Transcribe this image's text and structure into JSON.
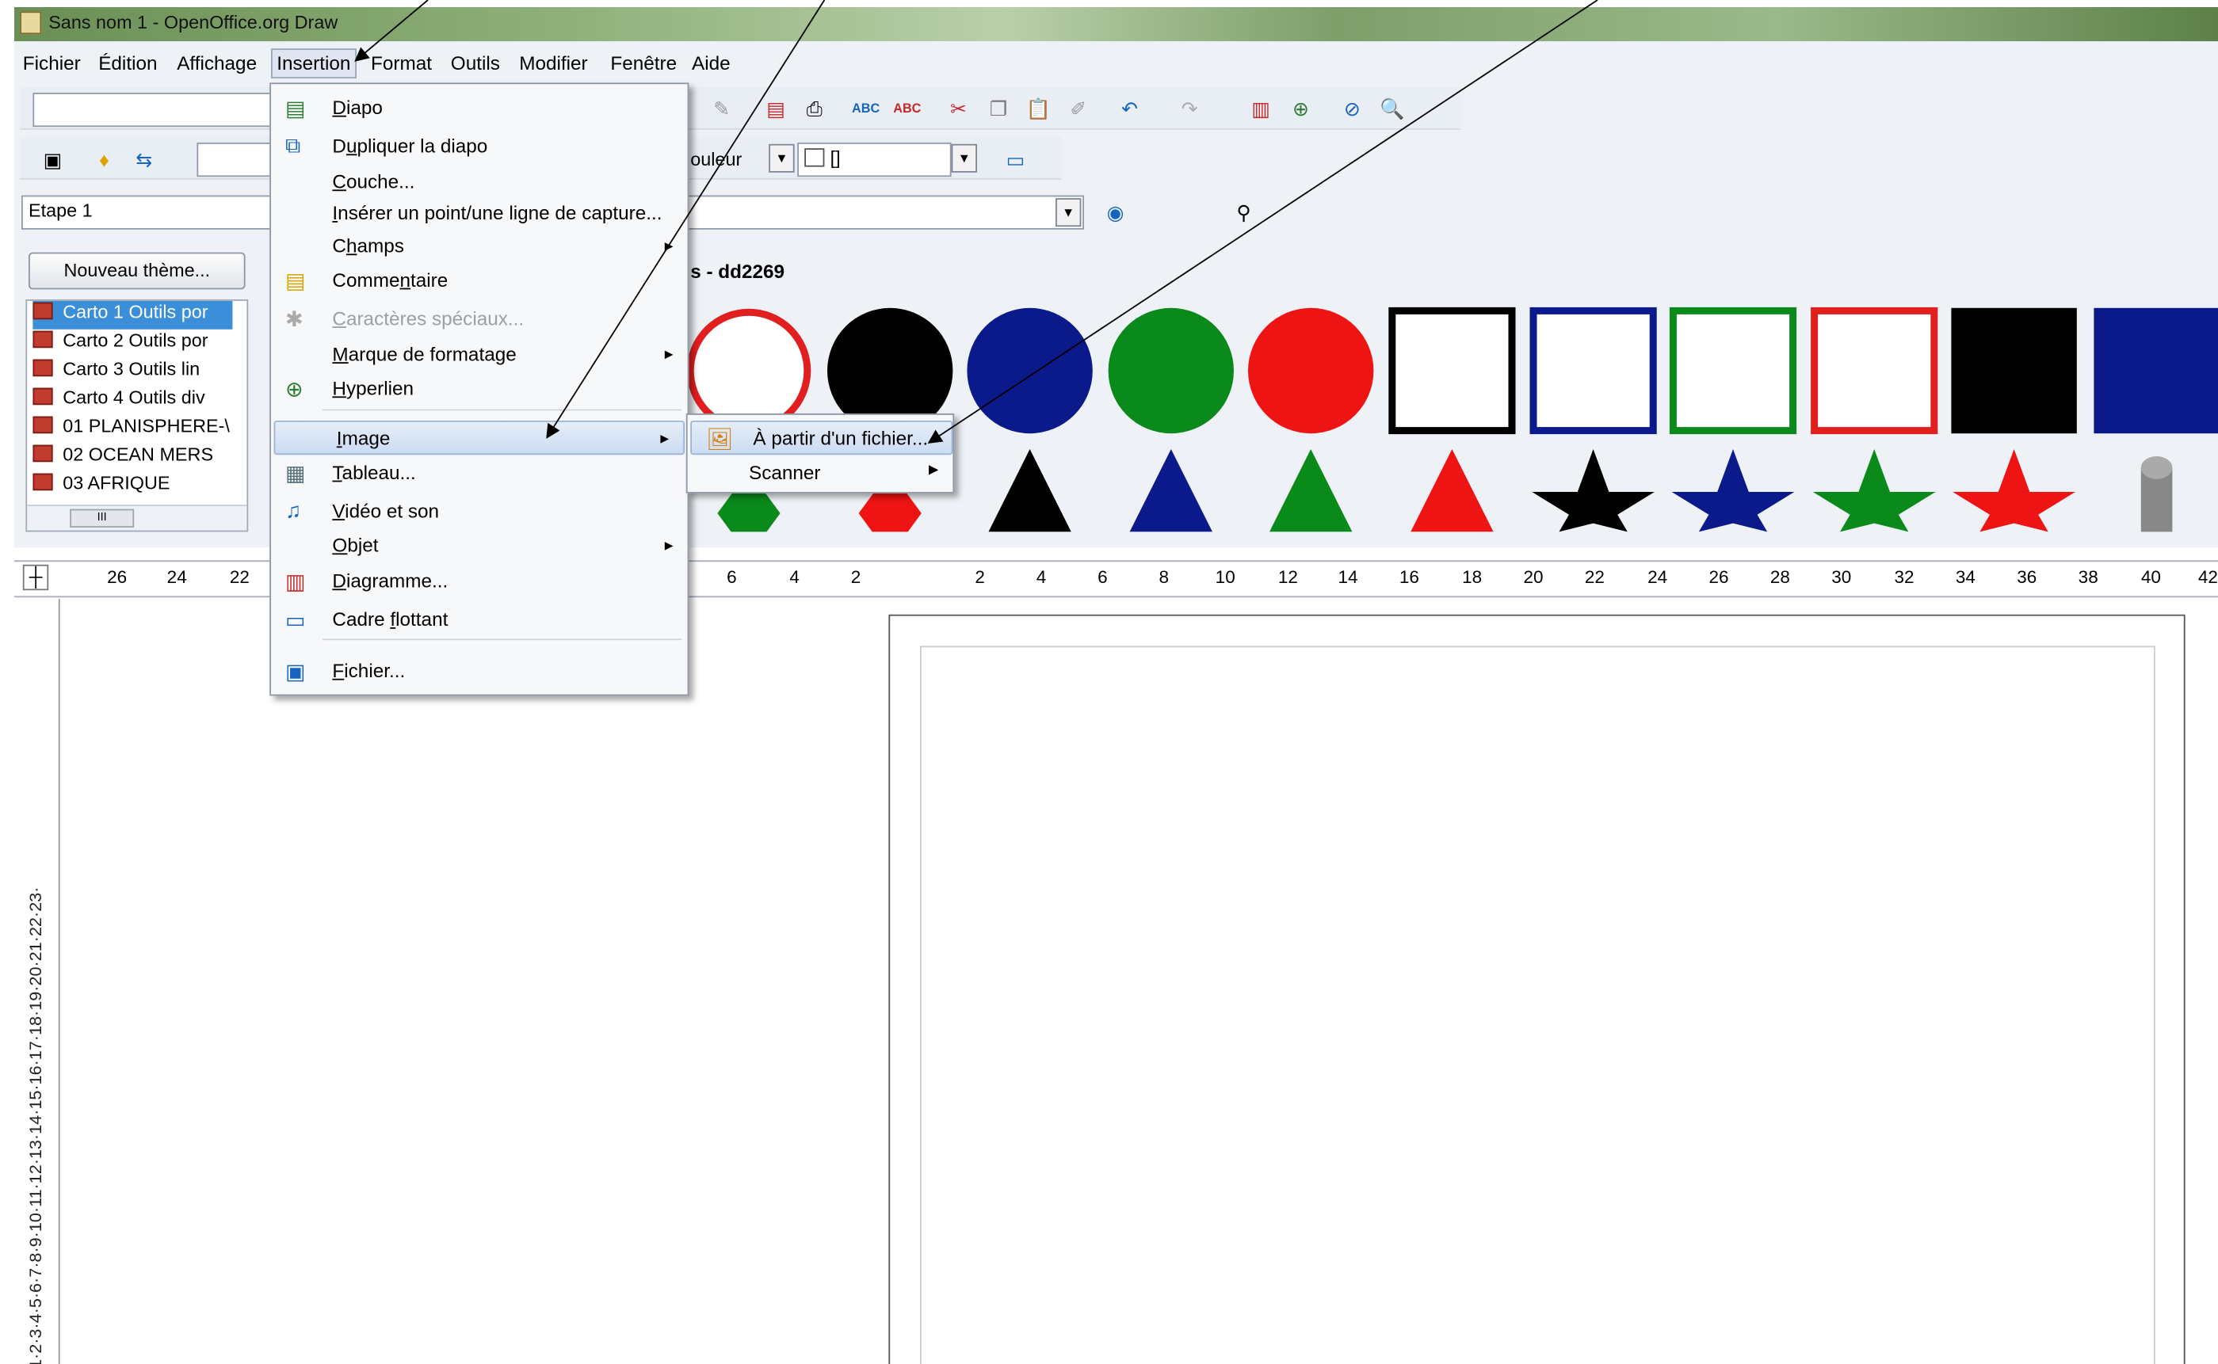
{
  "window": {
    "title": "Sans nom 1 - OpenOffice.org Draw"
  },
  "menubar": [
    "Fichier",
    "Édition",
    "Affichage",
    "Insertion",
    "Format",
    "Outils",
    "Modifier",
    "Fenêtre",
    "Aide"
  ],
  "toolbar2": {
    "color_label": "ouleur",
    "fill_value": "[]"
  },
  "toolbar3": {
    "step_value": "Etape 1"
  },
  "gallery": {
    "new_theme_button": "Nouveau thème...",
    "title": "s - dd2269",
    "themes": [
      "Carto 1 Outils por",
      "Carto 2 Outils por",
      "Carto 3 Outils  lin",
      "Carto 4 Outils div",
      "01 PLANISPHERE-\\",
      "02 OCEAN MERS",
      "03 AFRIQUE"
    ],
    "selected_theme": "Carto 1 Outils por",
    "scroll_thumb": "III",
    "shapes_row1": [
      {
        "shape": "circle-outline",
        "color": "#e21f1f"
      },
      {
        "shape": "circle",
        "color": "#000000"
      },
      {
        "shape": "circle",
        "color": "#0b1a8a"
      },
      {
        "shape": "circle",
        "color": "#0a8a1a"
      },
      {
        "shape": "circle",
        "color": "#ef1414"
      },
      {
        "shape": "square-outline",
        "color": "#000000"
      },
      {
        "shape": "square-outline",
        "color": "#0b1a8a"
      },
      {
        "shape": "square-outline",
        "color": "#0a8a1a"
      },
      {
        "shape": "square-outline",
        "color": "#e21f1f"
      },
      {
        "shape": "square",
        "color": "#000000"
      },
      {
        "shape": "square",
        "color": "#0b1a8a"
      }
    ],
    "shapes_row2": [
      {
        "shape": "hexagon",
        "color": "#0a8a1a"
      },
      {
        "shape": "hexagon",
        "color": "#ef1414"
      },
      {
        "shape": "triangle",
        "color": "#000000"
      },
      {
        "shape": "triangle",
        "color": "#0b1a8a"
      },
      {
        "shape": "triangle",
        "color": "#0a8a1a"
      },
      {
        "shape": "triangle",
        "color": "#ef1414"
      },
      {
        "shape": "star",
        "color": "#000000"
      },
      {
        "shape": "star",
        "color": "#0b1a8a"
      },
      {
        "shape": "star",
        "color": "#0a8a1a"
      },
      {
        "shape": "star",
        "color": "#ef1414"
      },
      {
        "shape": "cylinder",
        "color": "#888888"
      }
    ]
  },
  "ruler": {
    "h_ticks": [
      "26",
      "24",
      "22",
      "6",
      "4",
      "2",
      "2",
      "4",
      "6",
      "8",
      "10",
      "12",
      "14",
      "16",
      "18",
      "20",
      "22",
      "24",
      "26",
      "28",
      "30",
      "32",
      "34",
      "36",
      "38",
      "40",
      "42"
    ],
    "v_ticks": "·1·2·3·4·5·6·7·8·9·10·11·12·13·14·15·16·17·18·19·20·21·22·23·"
  },
  "insert_menu": {
    "items": [
      {
        "label": "Diapo",
        "u": "D",
        "icon": "slide-icon"
      },
      {
        "label": "Dupliquer la diapo",
        "u": "u",
        "icon": "duplicate-slide-icon"
      },
      {
        "label": "Couche...",
        "u": "C"
      },
      {
        "label": "Insérer un point/une ligne de capture...",
        "u": "I"
      },
      {
        "label": "Champs",
        "u": "h",
        "submenu": true
      },
      {
        "label": "Commentaire",
        "u": "n",
        "icon": "comment-icon"
      },
      {
        "label": "Caractères spéciaux...",
        "u": "C",
        "disabled": true,
        "icon": "special-char-icon"
      },
      {
        "label": "Marque de formatage",
        "u": "M",
        "submenu": true
      },
      {
        "label": "Hyperlien",
        "u": "H",
        "icon": "hyperlink-icon"
      },
      {
        "label": "Image",
        "u": "I",
        "submenu": true,
        "highlighted": true
      },
      {
        "label": "Tableau...",
        "u": "T",
        "icon": "table-icon"
      },
      {
        "label": "Vidéo et son",
        "u": "V",
        "icon": "video-icon"
      },
      {
        "label": "Objet",
        "u": "O",
        "submenu": true
      },
      {
        "label": "Diagramme...",
        "u": "D",
        "icon": "chart-icon"
      },
      {
        "label": "Cadre flottant",
        "u": "f",
        "icon": "frame-icon"
      },
      {
        "label": "Fichier...",
        "u": "F",
        "icon": "file-icon"
      }
    ]
  },
  "image_submenu": {
    "items": [
      {
        "label": "À partir d'un fichier...",
        "icon": "from-file-icon"
      },
      {
        "label": "Scanner",
        "submenu": true
      }
    ]
  },
  "colors": {
    "menu_highlight": "#cbdcf2",
    "selection": "#3b8ed8",
    "chrome": "#eef1f6"
  }
}
